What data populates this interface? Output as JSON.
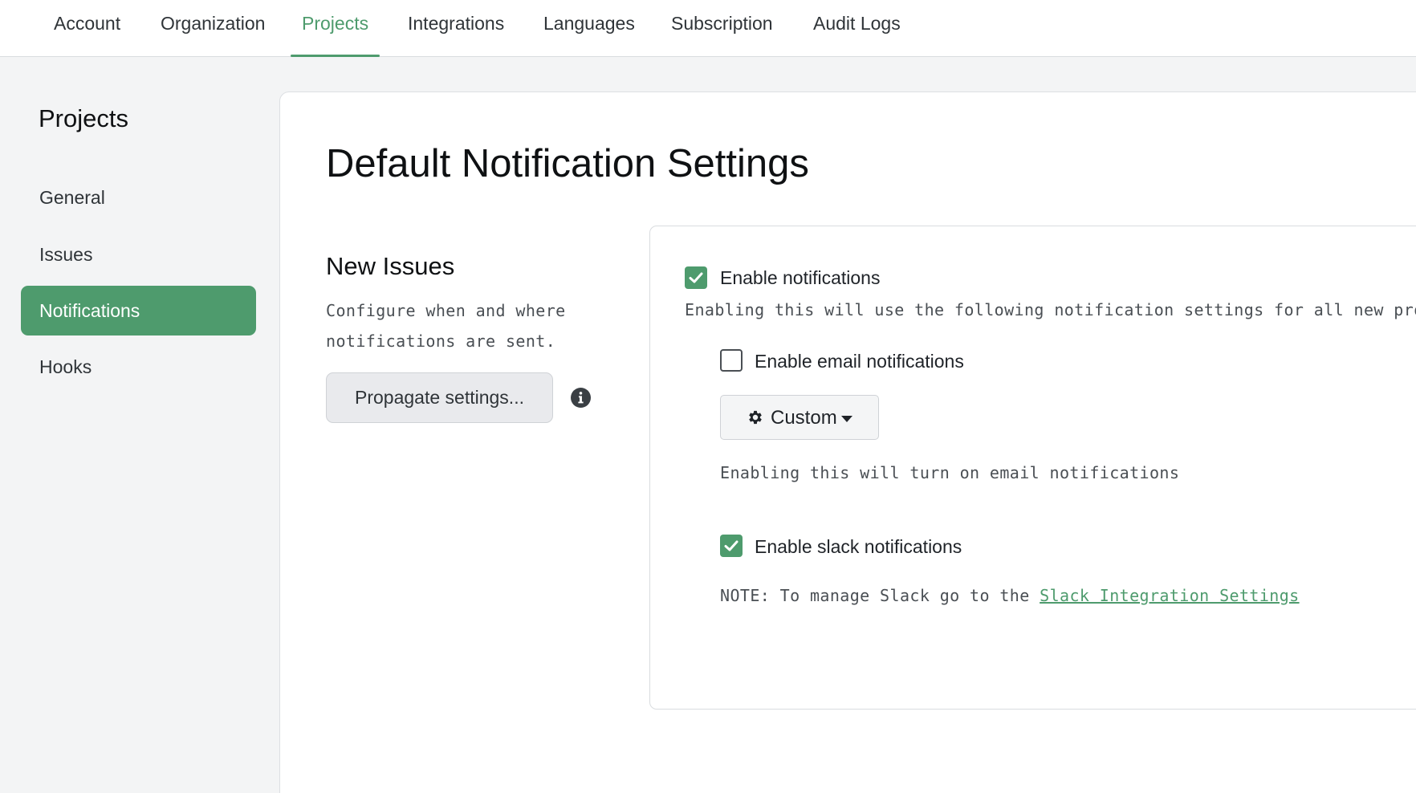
{
  "topnav": {
    "tabs": [
      {
        "label": "Account"
      },
      {
        "label": "Organization"
      },
      {
        "label": "Projects"
      },
      {
        "label": "Integrations"
      },
      {
        "label": "Languages"
      },
      {
        "label": "Subscription"
      },
      {
        "label": "Audit Logs"
      }
    ],
    "active": "Projects"
  },
  "sidebar": {
    "title": "Projects",
    "items": [
      {
        "label": "General"
      },
      {
        "label": "Issues"
      },
      {
        "label": "Notifications"
      },
      {
        "label": "Hooks"
      }
    ],
    "active": "Notifications"
  },
  "main": {
    "title": "Default Notification Settings",
    "section": {
      "title": "New Issues",
      "description": "Configure when and where notifications are sent.",
      "propagate_label": "Propagate settings...",
      "info_icon": "info-circle-icon"
    },
    "settings": {
      "enable_notifications": {
        "label": "Enable notifications",
        "checked": true,
        "help": "Enabling this will use the following notification settings for all new projects"
      },
      "email": {
        "label": "Enable email notifications",
        "checked": false,
        "dropdown_label": "Custom",
        "dropdown_icon": "gear-icon",
        "help": "Enabling this will turn on email notifications"
      },
      "slack": {
        "label": "Enable slack notifications",
        "checked": true,
        "note_prefix": "NOTE: To manage Slack go to the ",
        "note_link": "Slack Integration Settings"
      }
    }
  },
  "colors": {
    "accent": "#4e9b6d",
    "background": "#f3f4f5",
    "text": "#1f2328"
  }
}
